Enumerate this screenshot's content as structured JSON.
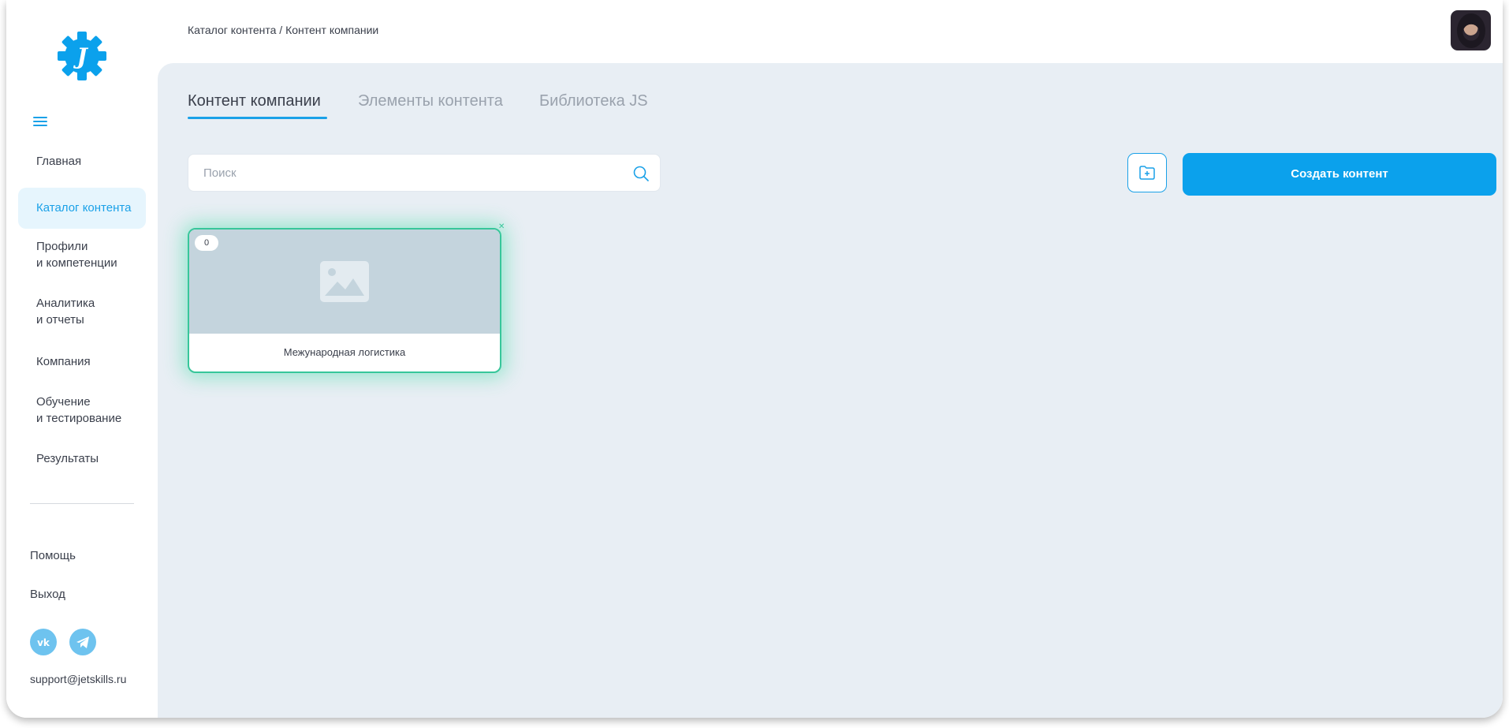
{
  "breadcrumb": "Каталог контента / Контент компании",
  "sidebar": {
    "items": [
      {
        "label": "Главная"
      },
      {
        "label": "Каталог контента",
        "active": true
      },
      {
        "label": "Профили\nи компетенции"
      },
      {
        "label": "Аналитика\nи отчеты"
      },
      {
        "label": "Компания"
      },
      {
        "label": "Обучение\nи тестирование"
      },
      {
        "label": "Результаты"
      }
    ],
    "help": "Помощь",
    "logout": "Выход",
    "support_email": "support@jetskills.ru",
    "social": [
      "vk-icon",
      "telegram-icon"
    ],
    "logo_letter": "J"
  },
  "tabs": [
    {
      "label": "Контент компании",
      "active": true
    },
    {
      "label": "Элементы контента"
    },
    {
      "label": "Библиотека JS"
    }
  ],
  "search": {
    "placeholder": "Поиск",
    "value": ""
  },
  "actions": {
    "create_label": "Создать контент"
  },
  "cards": [
    {
      "title": "Межународная логистика",
      "count": "0"
    }
  ],
  "colors": {
    "accent": "#0ba1ec",
    "main_bg": "#e8eef4",
    "card_border": "#37c69a"
  }
}
